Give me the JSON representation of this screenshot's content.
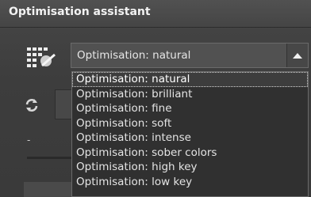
{
  "panel": {
    "title": "Optimisation assistant"
  },
  "preset_select": {
    "value": "Optimisation: natural",
    "options": [
      "Optimisation: natural",
      "Optimisation: brilliant",
      "Optimisation: fine",
      "Optimisation: soft",
      "Optimisation: intense",
      "Optimisation: sober colors",
      "Optimisation: high key",
      "Optimisation: low key"
    ],
    "highlighted_index": 0
  },
  "misc": {
    "dash_label": "-"
  },
  "icons": {
    "preset": "preset-grid-icon",
    "dropdown_arrow": "triangle-up-icon",
    "refresh": "refresh-icon"
  },
  "colors": {
    "background": "#3a3a3a",
    "header": "#4c4c4c",
    "dropdown": "#303030",
    "text": "#e4e4e4"
  }
}
